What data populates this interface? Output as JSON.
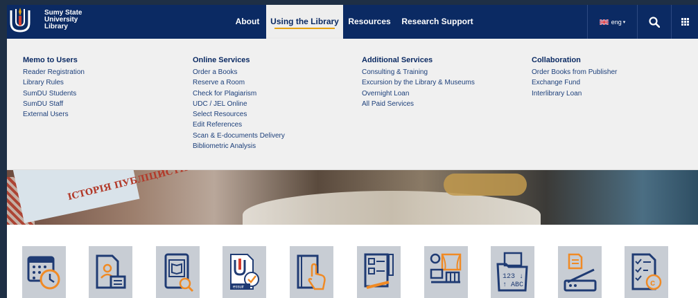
{
  "brand": {
    "lines": [
      "Sumy State",
      "University",
      "Library"
    ],
    "logo_icon": "library-emblem-icon"
  },
  "nav": {
    "items": [
      {
        "label": "About"
      },
      {
        "label": "Using the Library",
        "active": true
      },
      {
        "label": "Resources"
      },
      {
        "label": "Research Support"
      }
    ],
    "lang": "eng",
    "search_icon": "search-icon",
    "apps_icon": "grid-icon"
  },
  "menu": {
    "columns": [
      {
        "title": "Memo to Users",
        "links": [
          "Reader Registration",
          "Library Rules",
          "SumDU Students",
          "SumDU Staff",
          "External Users"
        ]
      },
      {
        "title": "Online Services",
        "links": [
          "Order a Books",
          "Reserve a Room",
          "Check for Plagiarism",
          "UDC / JEL Online",
          "Select Resources",
          "Edit References",
          "Scan & E-documents Delivery",
          "Bibliometric Analysis"
        ]
      },
      {
        "title": "Additional Services",
        "links": [
          "Consulting & Training",
          "Excursion by the Library & Museums",
          "Overnight Loan",
          "All Paid Services"
        ]
      },
      {
        "title": "Collaboration",
        "links": [
          "Order Books from Publisher",
          "Exchange Fund",
          "Interlibrary Loan"
        ]
      }
    ]
  },
  "hero": {
    "book_text": "ІСТОРІЯ ПУБЛІЦИСТИКИ"
  },
  "tiles": [
    {
      "icon": "calendar-clock-icon"
    },
    {
      "icon": "user-document-icon"
    },
    {
      "icon": "ebook-search-icon"
    },
    {
      "icon": "essuir-repository-icon",
      "caption": "essuir"
    },
    {
      "icon": "book-touch-icon"
    },
    {
      "icon": "form-pencil-icon"
    },
    {
      "icon": "workspace-room-icon"
    },
    {
      "icon": "udc-catalog-icon",
      "caption": "123 ABC"
    },
    {
      "icon": "scanner-icon"
    },
    {
      "icon": "paid-checklist-icon"
    }
  ],
  "colors": {
    "navbar": "#0b2a63",
    "accent": "#e6a10f",
    "menu_bg": "#f0f0f0",
    "tile_bg": "#c8cdd4",
    "icon_blue": "#1f3b73",
    "icon_orange": "#f08a24"
  }
}
